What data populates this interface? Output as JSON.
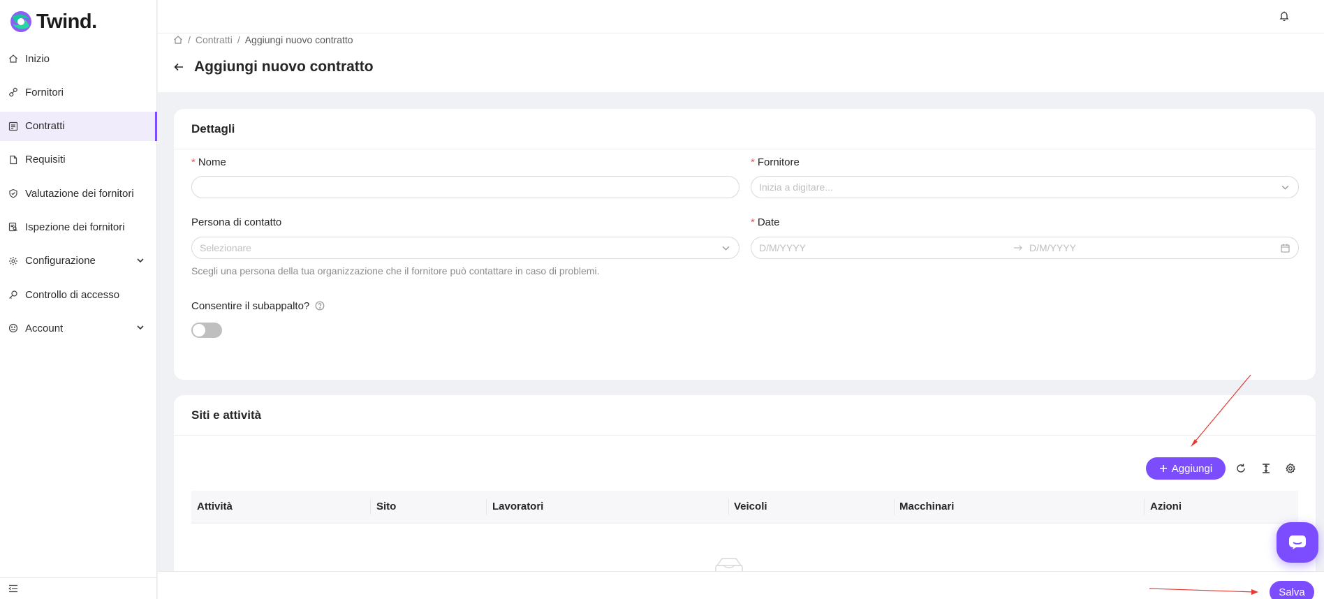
{
  "app": {
    "logo_text": "Twind."
  },
  "sidebar": {
    "items": [
      {
        "label": "Inizio",
        "icon": "home-icon"
      },
      {
        "label": "Fornitori",
        "icon": "link-icon"
      },
      {
        "label": "Contratti",
        "icon": "contract-icon",
        "active": true
      },
      {
        "label": "Requisiti",
        "icon": "file-icon"
      },
      {
        "label": "Valutazione dei fornitori",
        "icon": "shield-check-icon"
      },
      {
        "label": "Ispezione dei fornitori",
        "icon": "inspection-icon"
      },
      {
        "label": "Configurazione",
        "icon": "gear-icon",
        "expandable": true
      },
      {
        "label": "Controllo di accesso",
        "icon": "key-icon"
      },
      {
        "label": "Account",
        "icon": "smile-icon",
        "expandable": true
      }
    ]
  },
  "breadcrumb": {
    "items": [
      "Contratti",
      "Aggiungi nuovo contratto"
    ]
  },
  "page": {
    "title": "Aggiungi nuovo contratto"
  },
  "details": {
    "title": "Dettagli",
    "nome_label": "Nome",
    "nome_value": "",
    "fornitore_label": "Fornitore",
    "fornitore_placeholder": "Inizia a digitare...",
    "contatto_label": "Persona di contatto",
    "contatto_placeholder": "Selezionare",
    "contatto_hint": "Scegli una persona della tua organizzazione che il fornitore può contattare in caso di problemi.",
    "date_label": "Date",
    "date_start_placeholder": "D/M/YYYY",
    "date_end_placeholder": "D/M/YYYY",
    "subappalto_label": "Consentire il subappalto?",
    "subappalto_enabled": false
  },
  "sites": {
    "title": "Siti e attività",
    "add_label": "Aggiungi",
    "columns": [
      "Attività",
      "Sito",
      "Lavoratori",
      "Veicoli",
      "Macchinari",
      "Azioni"
    ]
  },
  "footer": {
    "save_label": "Salva"
  },
  "colors": {
    "accent": "#7c4dff",
    "active_bg": "#f1ecfb",
    "required": "#ff4d4f",
    "annotation": "#e53935"
  }
}
